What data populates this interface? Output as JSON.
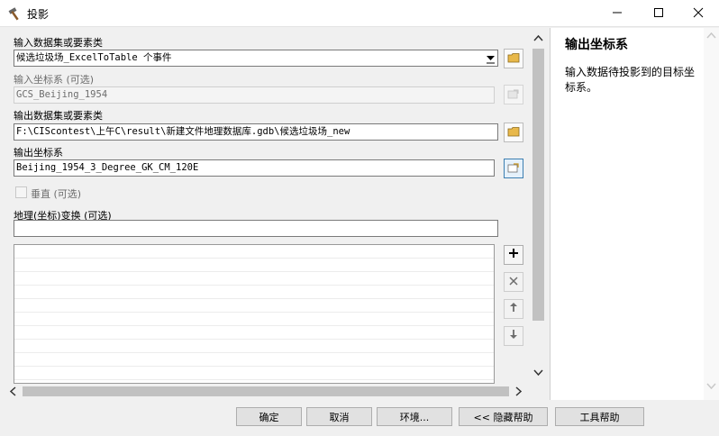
{
  "window": {
    "title": "投影",
    "icon": "hammer-icon",
    "controls": [
      "minimize-icon",
      "maximize-icon",
      "close-icon"
    ]
  },
  "form": {
    "input_dataset": {
      "label": "输入数据集或要素类",
      "value": "候选垃圾场_ExcelToTable 个事件"
    },
    "input_coord": {
      "label": "输入坐标系 (可选)",
      "value": "GCS_Beijing_1954"
    },
    "output_dataset": {
      "label": "输出数据集或要素类",
      "value": "F:\\CIScontest\\上午C\\result\\新建文件地理数据库.gdb\\候选垃圾场_new"
    },
    "output_coord": {
      "label": "输出坐标系",
      "value": "Beijing_1954_3_Degree_GK_CM_120E"
    },
    "vertical": {
      "label": "垂直 (可选)",
      "checked": false
    },
    "geo_transform": {
      "label": "地理(坐标)变换 (可选)",
      "value": ""
    }
  },
  "help": {
    "title": "输出坐标系",
    "text": "输入数据待投影到的目标坐标系。"
  },
  "buttons": {
    "ok": "确定",
    "cancel": "取消",
    "environments": "环境...",
    "hide_help": "<< 隐藏帮助",
    "tool_help": "工具帮助"
  },
  "colors": {
    "selected_border": "#3c7fb1",
    "folder_yellow": "#e8b84a"
  }
}
